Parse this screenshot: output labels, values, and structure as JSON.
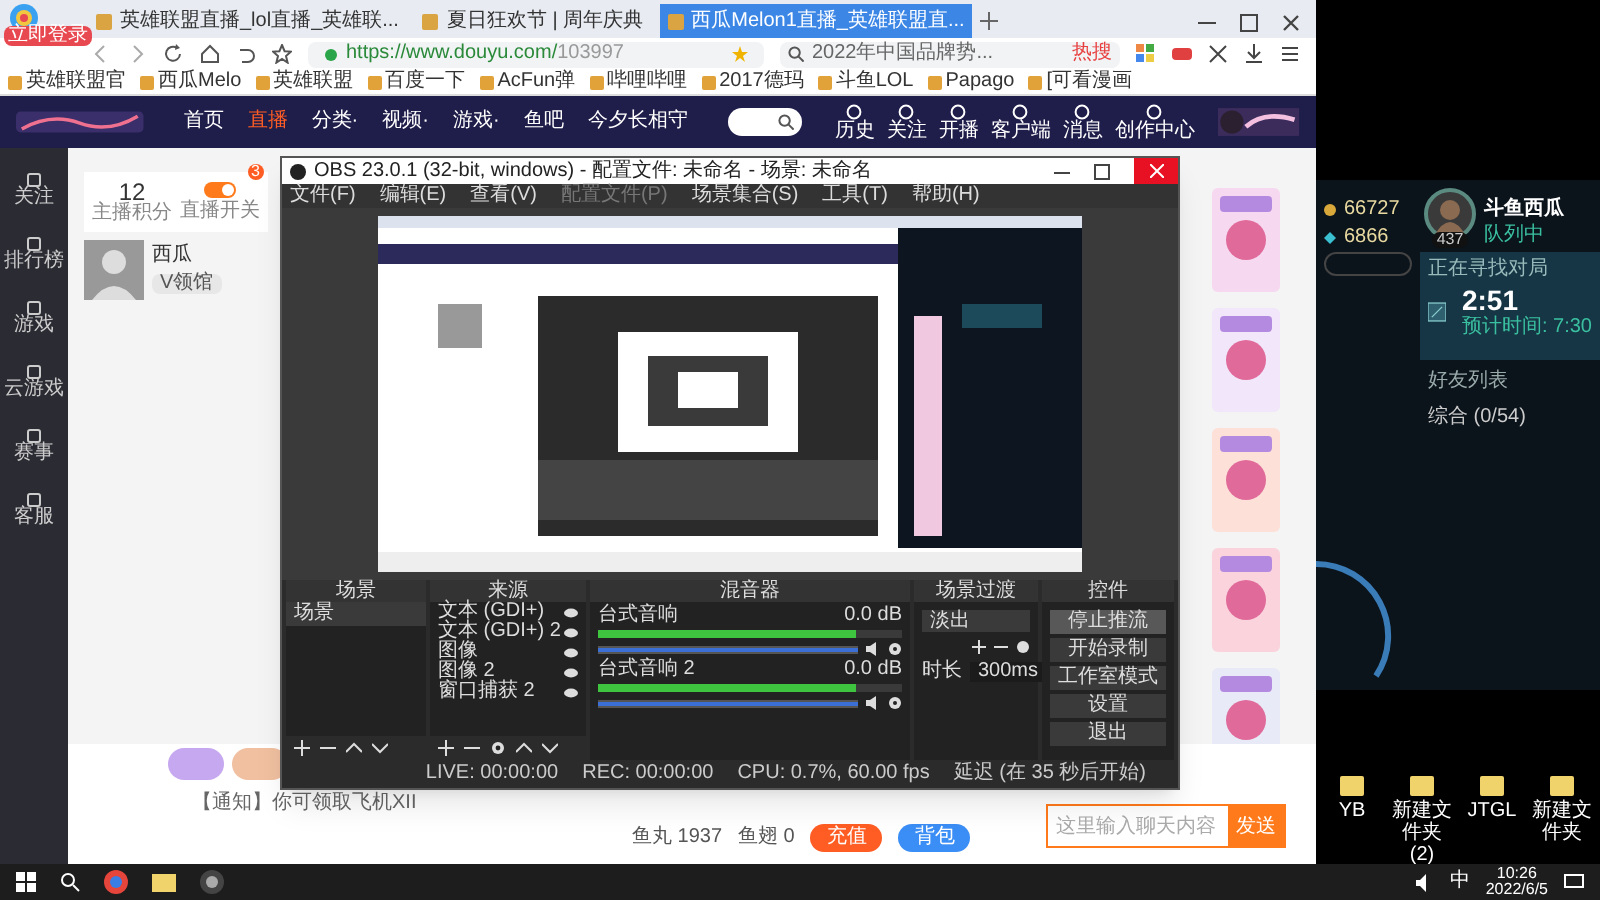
{
  "browser": {
    "tabs": [
      {
        "label": "英雄联盟直播_lol直播_英雄联...",
        "selected": false
      },
      {
        "label": "夏日狂欢节 | 周年庆典",
        "selected": false
      },
      {
        "label": "西瓜Melon1直播_英雄联盟直...",
        "selected": true
      }
    ],
    "badge": "立即登录",
    "url_host": "https://www.douyu.com/",
    "url_path": "103997",
    "search": "2022年中国品牌势...",
    "hot": "热搜",
    "bookmarks": [
      "英雄联盟官",
      "西瓜Melo",
      "英雄联盟",
      "百度一下",
      "AcFun弹",
      "哔哩哔哩",
      "2017德玛",
      "斗鱼LOL",
      "Papago",
      "[可看漫画"
    ]
  },
  "site": {
    "nav": [
      {
        "label": "首页",
        "selected": false
      },
      {
        "label": "直播",
        "selected": true
      },
      {
        "label": "分类·",
        "selected": false
      },
      {
        "label": "视频·",
        "selected": false
      },
      {
        "label": "游戏·",
        "selected": false
      },
      {
        "label": "鱼吧",
        "selected": false
      },
      {
        "label": "今夕长相守",
        "selected": false
      }
    ],
    "user_icons": [
      "历史",
      "关注",
      "开播",
      "客户端",
      "消息",
      "创作中心"
    ],
    "side": [
      "关注",
      "排行榜",
      "游戏",
      "云游戏",
      "赛事",
      "客服"
    ],
    "score": "12",
    "score_label": "主播积分",
    "switch_label": "直播开关",
    "live_on": true,
    "notice_count": "3",
    "streamer": "西瓜",
    "level_badge": "V领馆",
    "notice": "【通知】你可领取飞机XII",
    "fishball": "鱼丸 1937",
    "fishfin": "鱼翅 0",
    "recharge": "充值",
    "bag": "背包",
    "chat_placeholder": "这里输入聊天内容",
    "send": "发送"
  },
  "obs": {
    "title": "OBS 23.0.1 (32-bit, windows) - 配置文件: 未命名 - 场景: 未命名",
    "menu": [
      {
        "label": "文件(F)",
        "disabled": false
      },
      {
        "label": "编辑(E)",
        "disabled": false
      },
      {
        "label": "查看(V)",
        "disabled": false
      },
      {
        "label": "配置文件(P)",
        "disabled": true
      },
      {
        "label": "场景集合(S)",
        "disabled": false
      },
      {
        "label": "工具(T)",
        "disabled": false
      },
      {
        "label": "帮助(H)",
        "disabled": false
      }
    ],
    "docks": [
      "场景",
      "来源",
      "混音器",
      "场景过渡",
      "控件"
    ],
    "scenes": [
      {
        "label": "场景",
        "selected": true
      }
    ],
    "sources": [
      "文本 (GDI+)",
      "文本 (GDI+) 2",
      "图像",
      "图像 2",
      "窗口捕获 2"
    ],
    "mixer": [
      {
        "name": "台式音响",
        "reading": "0.0 dB",
        "meter": {
          "level": 0.85
        },
        "volume": {
          "level": 1
        }
      },
      {
        "name": "台式音响 2",
        "reading": "0.0 dB",
        "meter": {
          "level": 0.85
        },
        "volume": {
          "level": 1
        }
      }
    ],
    "transition": "淡出",
    "duration_label": "时长",
    "duration": "300ms",
    "controls": [
      {
        "label": "停止推流",
        "selected": true
      },
      {
        "label": "开始录制",
        "selected": false
      },
      {
        "label": "工作室模式",
        "selected": false
      },
      {
        "label": "设置",
        "selected": false
      },
      {
        "label": "退出",
        "selected": false
      }
    ],
    "status": [
      "LIVE: 00:00:00",
      "REC: 00:00:00",
      "CPU: 0.7%, 60.00 fps",
      "延迟 (在 35 秒后开始)"
    ]
  },
  "game": {
    "currency_1": "66727",
    "currency_2": "6866",
    "level": "437",
    "name": "斗鱼西瓜",
    "state": "队列中",
    "queue_title": "正在寻找对局",
    "timer": "2:51",
    "estimate": "预计时间: 7:30",
    "friends": "好友列表",
    "group": "综合 (0/54)"
  },
  "desktop": [
    "YB",
    "新建文件夹 (2)",
    "JTGL",
    "新建文件夹"
  ],
  "taskbar": {
    "ime": "中",
    "time": "10:26",
    "date": "2022/6/5"
  }
}
